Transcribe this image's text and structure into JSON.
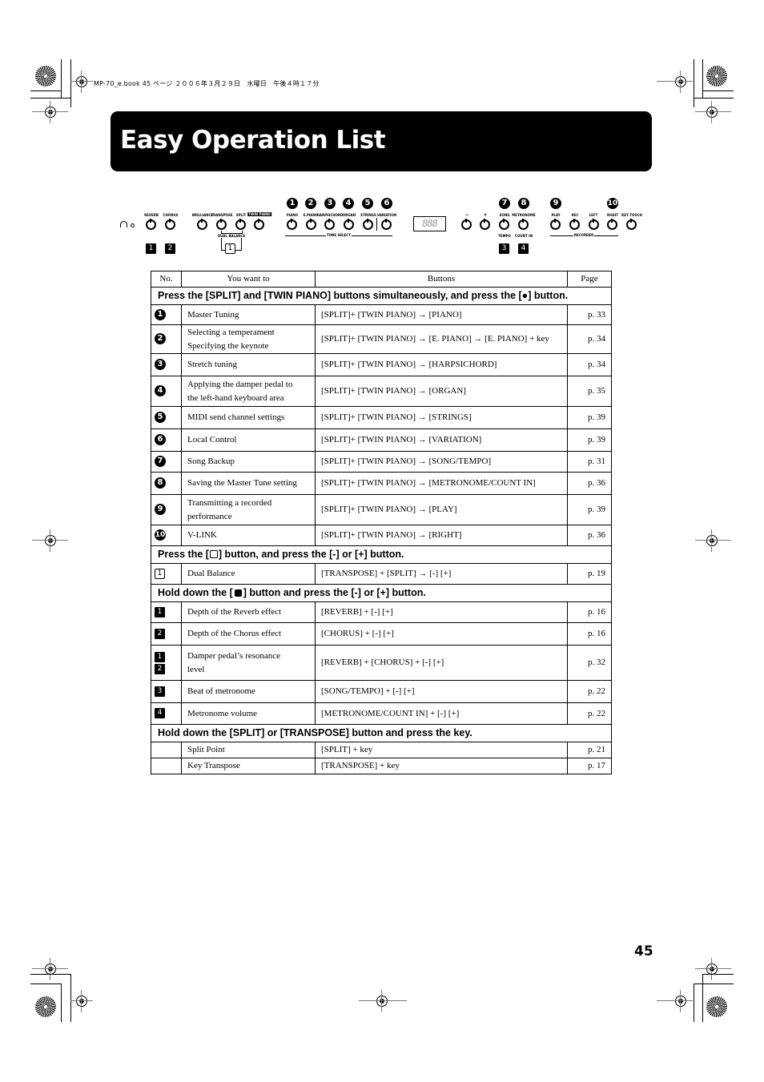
{
  "header_info": "MP-70_e.book  45 ページ  ２００６年３月２９日　水曜日　午後４時１７分",
  "title": "Easy Operation List",
  "page_number": "45",
  "panel": {
    "display_text": "888",
    "left_labels": [
      "REVERB",
      "CHORUS",
      "BRILLIANCE",
      "TRANSPOSE",
      "SPLIT",
      "TWIN PIANO"
    ],
    "dual_balance_label": "DUAL BALANCE",
    "tone_labels": [
      "PIANO",
      "E.PIANO",
      "HARPSICHORD",
      "ORGAN",
      "STRINGS",
      "VARIATION"
    ],
    "tone_group_label": "TONE SELECT",
    "right_labels": [
      "−",
      "+",
      "SONG",
      "METRONOME",
      "PLAY",
      "REC",
      "LEFT",
      "RIGHT",
      "KEY TOUCH"
    ],
    "sub_labels": [
      "TEMPO",
      "COUNT IN"
    ],
    "recorder_group_label": "RECORDER",
    "circle_markers": [
      "1",
      "2",
      "3",
      "4",
      "5",
      "6",
      "7",
      "8",
      "9",
      "10"
    ],
    "square_markers": [
      "1",
      "2",
      "3",
      "4"
    ],
    "open_square_marker": "1"
  },
  "table": {
    "headers": [
      "No.",
      "You want to",
      "Buttons",
      "Page"
    ],
    "sections": [
      {
        "heading": "Press the [SPLIT] and [TWIN PIANO] buttons simultaneously, and press the [●] button.",
        "rows": [
          {
            "no": "1",
            "want": "Master Tuning",
            "buttons": "[SPLIT]+ [TWIN PIANO] → [PIANO]",
            "page": "p. 33"
          },
          {
            "no": "2",
            "want": "Selecting a temperament",
            "want2": "Specifying the keynote",
            "buttons": "[SPLIT]+ [TWIN PIANO] → [E. PIANO] → [E. PIANO] + key",
            "page": "p. 34"
          },
          {
            "no": "3",
            "want": "Stretch tuning",
            "buttons": "[SPLIT]+ [TWIN PIANO] → [HARPSICHORD]",
            "page": "p. 34"
          },
          {
            "no": "4",
            "want": "Applying the damper pedal to",
            "want2": "the left-hand keyboard area",
            "buttons": "[SPLIT]+ [TWIN PIANO] → [ORGAN]",
            "page": "p. 35"
          },
          {
            "no": "5",
            "want": "MIDI send channel settings",
            "buttons": "[SPLIT]+ [TWIN PIANO] → [STRINGS]",
            "page": "p. 39"
          },
          {
            "no": "6",
            "want": "Local Control",
            "buttons": "[SPLIT]+ [TWIN PIANO] → [VARIATION]",
            "page": "p. 39"
          },
          {
            "no": "7",
            "want": "Song Backup",
            "buttons": "[SPLIT]+ [TWIN PIANO] → [SONG/TEMPO]",
            "page": "p. 31"
          },
          {
            "no": "8",
            "want": "Saving the Master Tune setting",
            "buttons": "[SPLIT]+ [TWIN PIANO] → [METRONOME/COUNT IN]",
            "page": "p. 36"
          },
          {
            "no": "9",
            "want": "Transmitting a recorded",
            "want2": "performance",
            "buttons": "[SPLIT]+ [TWIN PIANO] → [PLAY]",
            "page": "p. 39"
          },
          {
            "no": "10",
            "want": "V-LINK",
            "buttons": "[SPLIT]+ [TWIN PIANO] → [RIGHT]",
            "page": "p. 36"
          }
        ]
      },
      {
        "heading_pre": "Press the [",
        "heading_post": "] button, and press the [-] or [+] button.",
        "rows": [
          {
            "no": "1",
            "want": "Dual Balance",
            "buttons": "[TRANSPOSE] + [SPLIT] → [-] [+]",
            "page": "p. 19"
          }
        ]
      },
      {
        "heading_pre": "Hold down the [",
        "heading_post": "] button and press the [-] or [+] button.",
        "rows": [
          {
            "no": "1",
            "want": "Depth of the Reverb effect",
            "buttons": "[REVERB] + [-] [+]",
            "page": "p. 16"
          },
          {
            "no": "2",
            "want": "Depth of the Chorus effect",
            "buttons": "[CHORUS] + [-] [+]",
            "page": "p. 16"
          },
          {
            "no": "1",
            "no2": "2",
            "want": "Damper pedal’s resonance",
            "want2": "level",
            "buttons": "[REVERB] + [CHORUS] + [-] [+]",
            "page": "p. 32"
          },
          {
            "no": "3",
            "want": "Beat of metronome",
            "buttons": "[SONG/TEMPO] + [-] [+]",
            "page": "p. 22"
          },
          {
            "no": "4",
            "want": "Metronome volume",
            "buttons": "[METRONOME/COUNT IN] + [-] [+]",
            "page": "p. 22"
          }
        ]
      },
      {
        "heading": "Hold down the [SPLIT] or [TRANSPOSE] button and press the key.",
        "rows": [
          {
            "no": "",
            "want": "Split Point",
            "buttons": "[SPLIT] + key",
            "page": "p. 21"
          },
          {
            "no": "",
            "want": "Key Transpose",
            "buttons": "[TRANSPOSE] + key",
            "page": "p. 17"
          }
        ]
      }
    ]
  }
}
